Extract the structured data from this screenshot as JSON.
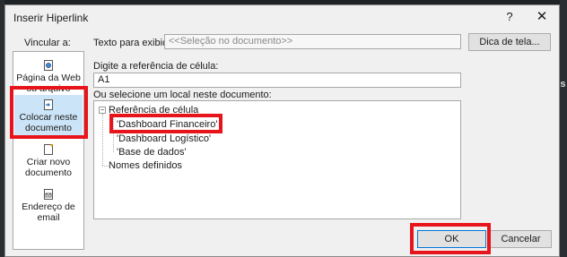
{
  "dialog": {
    "title": "Inserir Hiperlink",
    "help_icon": "?",
    "close_icon": "✕"
  },
  "sidebar": {
    "header": "Vincular a:",
    "items": [
      {
        "label": "Página da Web ou arquivo existente",
        "icon": "globe-file-icon",
        "selected": false
      },
      {
        "label": "Colocar neste documento",
        "icon": "document-place-icon",
        "selected": true
      },
      {
        "label": "Criar novo documento",
        "icon": "new-document-icon",
        "selected": false
      },
      {
        "label": "Endereço de email",
        "icon": "email-icon",
        "selected": false
      }
    ]
  },
  "form": {
    "display_text_label": "Texto para exibição:",
    "display_text_value": "<<Seleção no documento>>",
    "screen_tip_button": "Dica de tela...",
    "cell_ref_label": "Digite a referência de célula:",
    "cell_ref_value": "A1",
    "location_label": "Ou selecione um local neste documento:"
  },
  "tree": {
    "root_cell_ref": "Referência de célula",
    "sheets": [
      "'Dashboard Financeiro'",
      "'Dashboard Logístico'",
      "'Base de dados'"
    ],
    "selected_sheet_index": 0,
    "defined_names": "Nomes definidos"
  },
  "buttons": {
    "ok": "OK",
    "cancel": "Cancelar"
  },
  "backdrop": {
    "edge_text": "Es"
  },
  "colors": {
    "highlight_box": "#e8141b",
    "selection": "#cce4f7",
    "dialog_bg": "#f0f0f0"
  }
}
